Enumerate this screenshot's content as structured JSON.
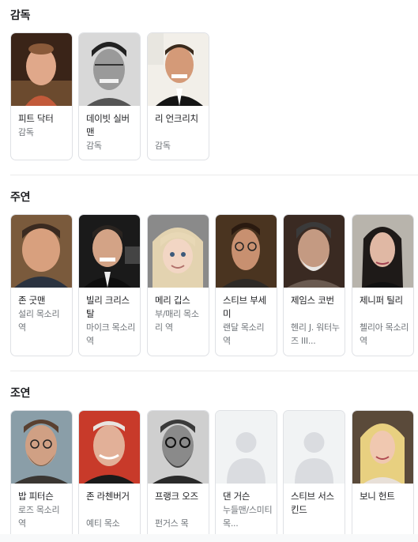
{
  "sections": {
    "director": {
      "title": "감독"
    },
    "lead": {
      "title": "주연"
    },
    "support": {
      "title": "조연"
    }
  },
  "directors": [
    {
      "name": "피트 닥터",
      "role": "감독"
    },
    {
      "name": "데이빗 실버맨",
      "role": "감독"
    },
    {
      "name": "리 언크리치",
      "role": "감독"
    }
  ],
  "lead_cast": [
    {
      "name": "존 굿맨",
      "role": "설리 목소리 역"
    },
    {
      "name": "빌리 크리스탈",
      "role": "마이크 목소리 역"
    },
    {
      "name": "메리 깁스",
      "role": "부/매리 목소리 역"
    },
    {
      "name": "스티브 부세미",
      "role": "랜달 목소리 역"
    },
    {
      "name": "제임스 코번",
      "role": "헨리 J. 워터누즈 III..."
    },
    {
      "name": "제니퍼 틸리",
      "role": "첼리아 목소리 역"
    }
  ],
  "support_cast": [
    {
      "name": "밥 피터슨",
      "role": "로즈 목소리 역"
    },
    {
      "name": "존 라첸버거",
      "role": "예티 목소"
    },
    {
      "name": "프랭크 오즈",
      "role": "펀거스 목"
    },
    {
      "name": "댄 거슨",
      "role": "누들맨/스미티 목..."
    },
    {
      "name": "스티브 서스킨드",
      "role": ""
    },
    {
      "name": "보니 헌트",
      "role": ""
    }
  ],
  "colors": {
    "card_border": "#dfe1e5",
    "secondary_text": "#70757a",
    "placeholder_bg": "#f1f3f4",
    "placeholder_icon": "#dadce0"
  }
}
